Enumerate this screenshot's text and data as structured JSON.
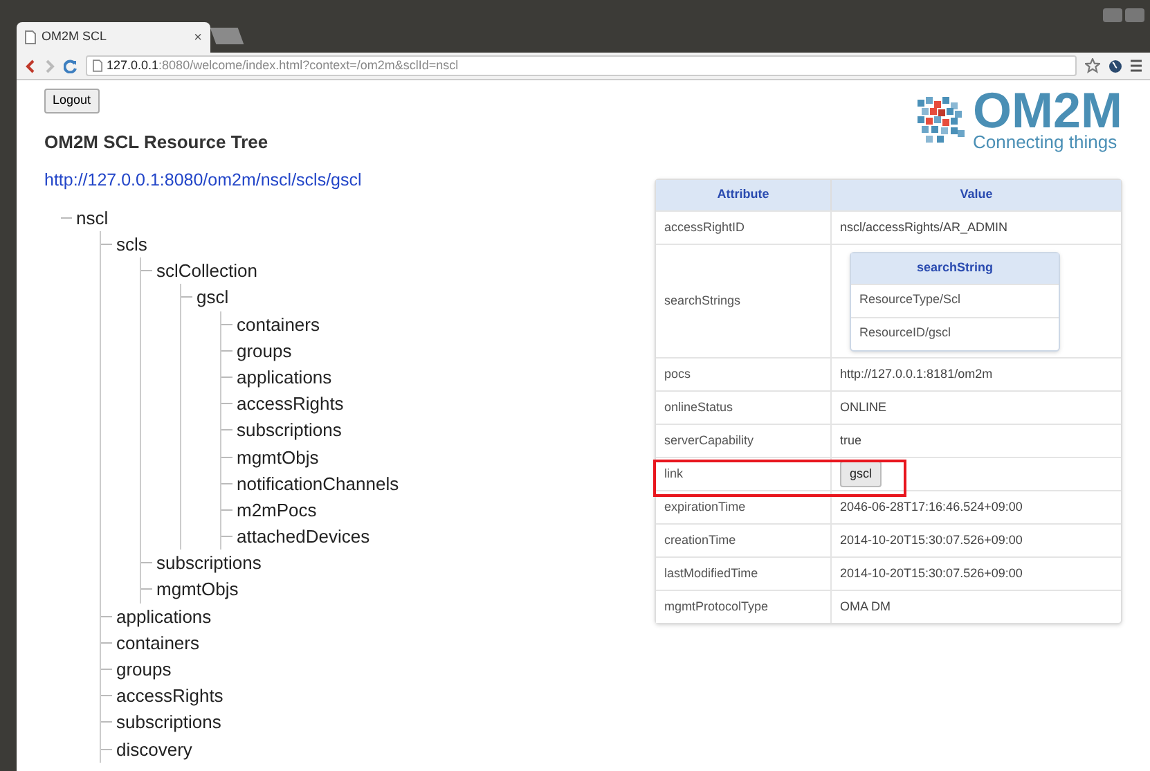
{
  "browser": {
    "tab": {
      "title": "OM2M SCL",
      "close": "×"
    },
    "url": {
      "host": "127.0.0.1",
      "rest": ":8080/welcome/index.html?context=/om2m&sclId=nscl"
    }
  },
  "logout": "Logout",
  "title": "OM2M SCL Resource Tree",
  "link": "http://127.0.0.1:8080/om2m/nscl/scls/gscl",
  "logo": {
    "name": "OM2M",
    "tagline": "Connecting things"
  },
  "tree": [
    {
      "label": "nscl",
      "children": [
        {
          "label": "scls",
          "children": [
            {
              "label": "sclCollection",
              "children": [
                {
                  "label": "gscl",
                  "children": [
                    {
                      "label": "containers"
                    },
                    {
                      "label": "groups"
                    },
                    {
                      "label": "applications"
                    },
                    {
                      "label": "accessRights"
                    },
                    {
                      "label": "subscriptions"
                    },
                    {
                      "label": "mgmtObjs"
                    },
                    {
                      "label": "notificationChannels"
                    },
                    {
                      "label": "m2mPocs"
                    },
                    {
                      "label": "attachedDevices"
                    }
                  ]
                }
              ]
            },
            {
              "label": "subscriptions"
            },
            {
              "label": "mgmtObjs"
            }
          ]
        },
        {
          "label": "applications"
        },
        {
          "label": "containers"
        },
        {
          "label": "groups"
        },
        {
          "label": "accessRights"
        },
        {
          "label": "subscriptions"
        },
        {
          "label": "discovery"
        }
      ]
    }
  ],
  "table": {
    "columns": [
      "Attribute",
      "Value"
    ],
    "rows": [
      {
        "kind": "text",
        "attribute": "accessRightID",
        "value": "nscl/accessRights/AR_ADMIN"
      },
      {
        "kind": "list",
        "attribute": "searchStrings",
        "heading": "searchString",
        "items": [
          "ResourceType/Scl",
          "ResourceID/gscl"
        ]
      },
      {
        "kind": "text",
        "attribute": "pocs",
        "value": "http://127.0.0.1:8181/om2m"
      },
      {
        "kind": "text",
        "attribute": "onlineStatus",
        "value": "ONLINE"
      },
      {
        "kind": "text",
        "attribute": "serverCapability",
        "value": "true"
      },
      {
        "kind": "button",
        "attribute": "link",
        "value": "gscl",
        "highlighted": true
      },
      {
        "kind": "text",
        "attribute": "expirationTime",
        "value": "2046-06-28T17:16:46.524+09:00"
      },
      {
        "kind": "text",
        "attribute": "creationTime",
        "value": "2014-10-20T15:30:07.526+09:00"
      },
      {
        "kind": "text",
        "attribute": "lastModifiedTime",
        "value": "2014-10-20T15:30:07.526+09:00"
      },
      {
        "kind": "text",
        "attribute": "mgmtProtocolType",
        "value": "OMA DM"
      }
    ]
  }
}
